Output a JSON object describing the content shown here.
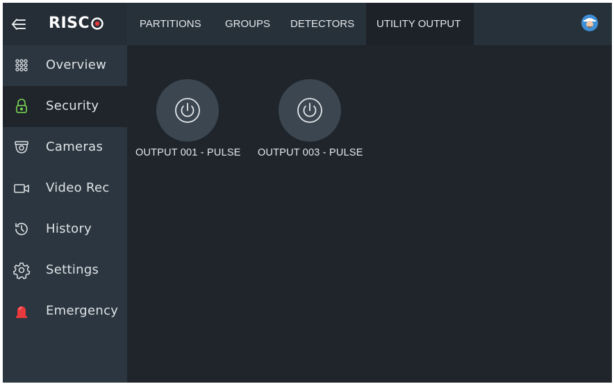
{
  "brand": {
    "logo_text": "RISC",
    "accent": "#e8393d"
  },
  "sidebar": {
    "items": [
      {
        "label": "Overview",
        "icon": "grid-dots-icon",
        "active": false
      },
      {
        "label": "Security",
        "icon": "lock-icon",
        "active": true,
        "icon_color": "#7ed957"
      },
      {
        "label": "Cameras",
        "icon": "camera-icon",
        "active": false
      },
      {
        "label": "Video Rec",
        "icon": "video-icon",
        "active": false
      },
      {
        "label": "History",
        "icon": "history-icon",
        "active": false
      },
      {
        "label": "Settings",
        "icon": "gear-icon",
        "active": false
      },
      {
        "label": "Emergency",
        "icon": "siren-icon",
        "active": false,
        "icon_color": "#e8393d"
      }
    ]
  },
  "topbar": {
    "tabs": [
      {
        "label": "PARTITIONS",
        "active": false
      },
      {
        "label": "GROUPS",
        "active": false
      },
      {
        "label": "DETECTORS",
        "active": false
      },
      {
        "label": "UTILITY OUTPUT",
        "active": true
      }
    ],
    "avatar_icon": "user-avatar-icon"
  },
  "outputs": [
    {
      "label": "OUTPUT 001 - PULSE",
      "icon": "power-icon"
    },
    {
      "label": "OUTPUT 003 - PULSE",
      "icon": "power-icon"
    }
  ]
}
